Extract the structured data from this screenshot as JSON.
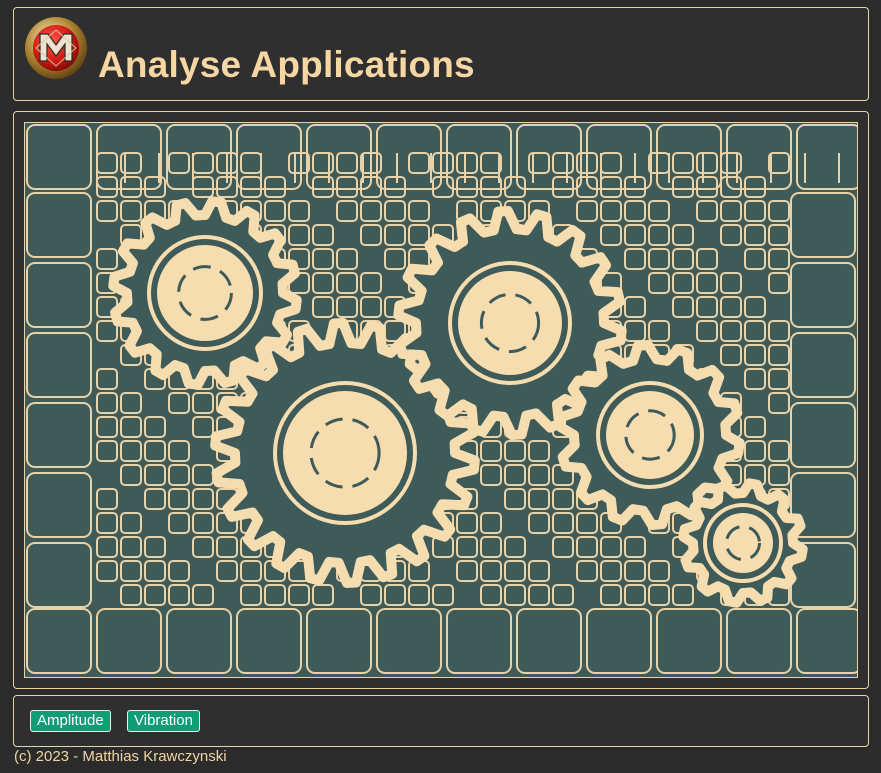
{
  "header": {
    "title": "Analyse Applications",
    "logo": "mk-logo"
  },
  "main": {
    "illustration": "gears-illustration",
    "colors": {
      "background": "#3e5a59",
      "accent": "#f6ddb0"
    }
  },
  "actions": {
    "amplitude_label": "Amplitude",
    "vibration_label": "Vibration"
  },
  "footer": {
    "copyright": "(c) 2023 - Matthias Krawczynski"
  }
}
